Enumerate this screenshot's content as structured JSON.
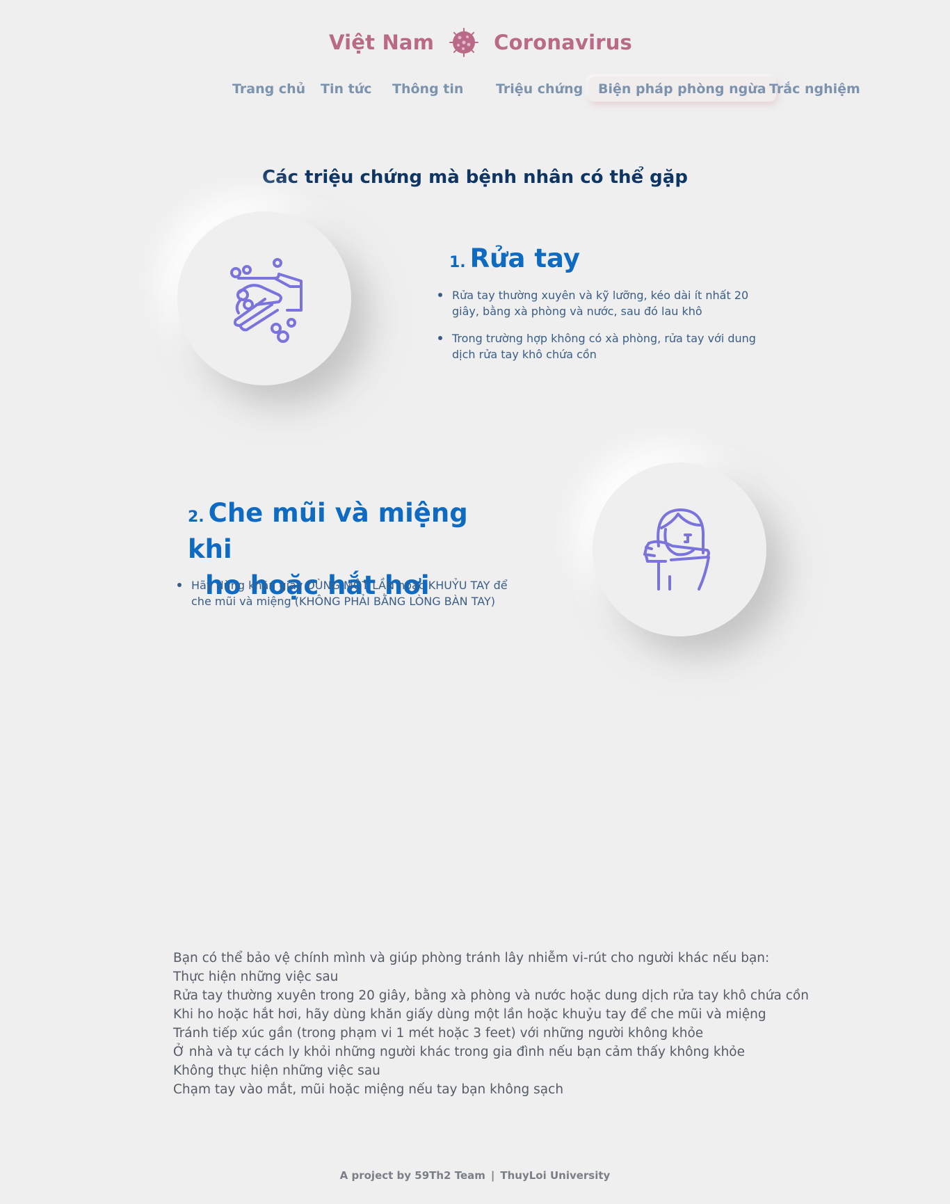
{
  "brand": {
    "left": "Việt Nam",
    "right": "Coronavirus",
    "icon": "virus-icon"
  },
  "nav": {
    "items": [
      {
        "label": "Trang chủ"
      },
      {
        "label": "Tin tức"
      },
      {
        "label": "Thông tin"
      },
      {
        "label": "Triệu chứng"
      },
      {
        "label": "Biện pháp phòng ngừa",
        "active": true
      },
      {
        "label": "Trắc nghiệm"
      }
    ]
  },
  "section": {
    "title": "Các triệu chứng mà bệnh nhân có thể gặp"
  },
  "steps": [
    {
      "number": "1.",
      "title": "Rửa tay",
      "icon": "handwashing-icon",
      "bullets": [
        "Rửa tay thường xuyên và kỹ lưỡng, kéo dài ít nhất 20 giây, bằng xà phòng và nước, sau đó lau khô",
        "Trong trường hợp không có xà phòng, rửa tay với dung dịch rửa tay khô chứa cồn"
      ]
    },
    {
      "number": "2.",
      "title_line1": "Che mũi và miệng khi",
      "title_line2": "ho hoặc hắt hơi",
      "icon": "cough-into-elbow-icon",
      "bullets": [
        "Hãy dùng khăn giấy DÙNG MỘT LẦN hoặc KHUỶU TAY để che mũi và miệng (KHÔNG PHẢI BẰNG LÒNG BÀN TAY)"
      ]
    }
  ],
  "advice": {
    "lines": [
      "Bạn có thể bảo vệ chính mình và giúp phòng tránh lây nhiễm vi-rút cho người khác nếu bạn:",
      "Thực hiện những việc sau",
      "Rửa tay thường xuyên trong 20 giây, bằng xà phòng và nước hoặc dung dịch rửa tay khô chứa cồn",
      "Khi ho hoặc hắt hơi, hãy dùng khăn giấy dùng một lần hoặc khuỷu tay để che mũi và miệng",
      "Tránh tiếp xúc gần (trong phạm vi 1 mét hoặc 3 feet) với những người không khỏe",
      "Ở nhà và tự cách ly khỏi những người khác trong gia đình nếu bạn cảm thấy không khỏe",
      "Không thực hiện những việc sau",
      "Chạm tay vào mắt, mũi hoặc miệng nếu tay bạn không sạch"
    ]
  },
  "footer": {
    "left": "A project by 59Th2 Team",
    "separator": "|",
    "right": "ThuyLoi University"
  },
  "colors": {
    "background": "#efefef",
    "brand": "#b86a86",
    "nav": "#7c93ae",
    "title": "#0f3563",
    "step_heading": "#0e6bc1",
    "bullet_text": "#3a5d86",
    "icon_stroke": "#7b73dc",
    "body_text": "#555c66"
  }
}
